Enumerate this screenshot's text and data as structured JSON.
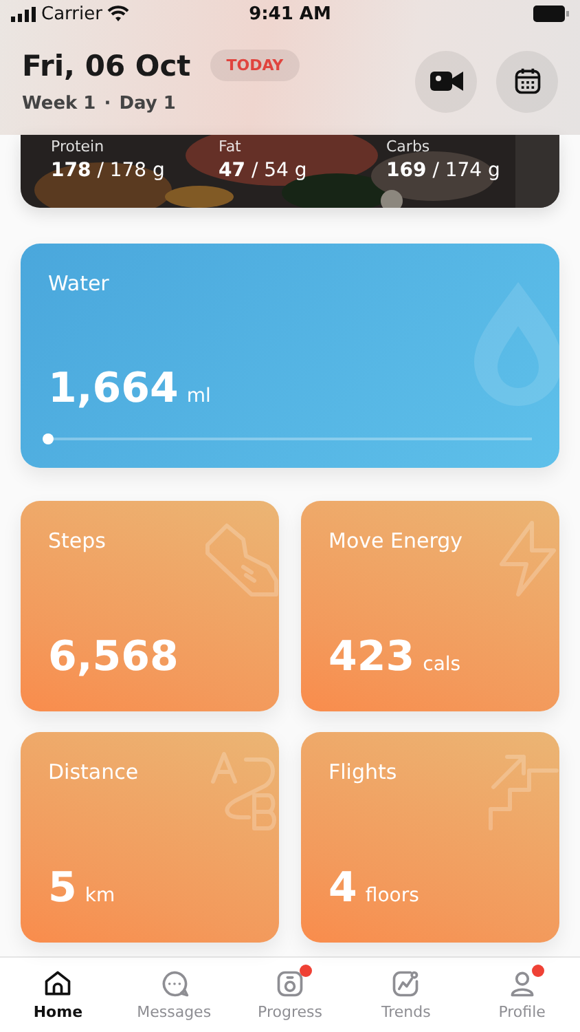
{
  "status_bar": {
    "carrier": "Carrier",
    "time": "9:41 AM"
  },
  "header": {
    "date": "Fri, 06 Oct",
    "badge": "TODAY",
    "week": "Week 1",
    "separator": "·",
    "day": "Day 1"
  },
  "macros": [
    {
      "label": "Protein",
      "value": "178",
      "target": "/ 178 g"
    },
    {
      "label": "Fat",
      "value": "47",
      "target": "/ 54 g"
    },
    {
      "label": "Carbs",
      "value": "169",
      "target": "/ 174 g"
    }
  ],
  "water": {
    "title": "Water",
    "value": "1,664",
    "unit": "ml",
    "level": 0.0
  },
  "tiles": [
    {
      "kind": "steps",
      "title": "Steps",
      "value": "6,568"
    },
    {
      "kind": "energy",
      "title": "Move Energy",
      "value": "423",
      "unit": "cals"
    },
    {
      "kind": "distance",
      "title": "Distance",
      "value": "5",
      "unit": "km"
    },
    {
      "kind": "flights",
      "title": "Flights",
      "value": "4",
      "unit": "floors"
    }
  ],
  "tab_bar": [
    {
      "kind": "home",
      "label": "Home",
      "selected": true,
      "notification": false
    },
    {
      "kind": "messages",
      "label": "Messages",
      "selected": false,
      "notification": false
    },
    {
      "kind": "progress",
      "label": "Progress",
      "selected": false,
      "notification": true
    },
    {
      "kind": "trends",
      "label": "Trends",
      "selected": false,
      "notification": false
    },
    {
      "kind": "profile",
      "label": "Profile",
      "selected": false,
      "notification": true
    }
  ]
}
